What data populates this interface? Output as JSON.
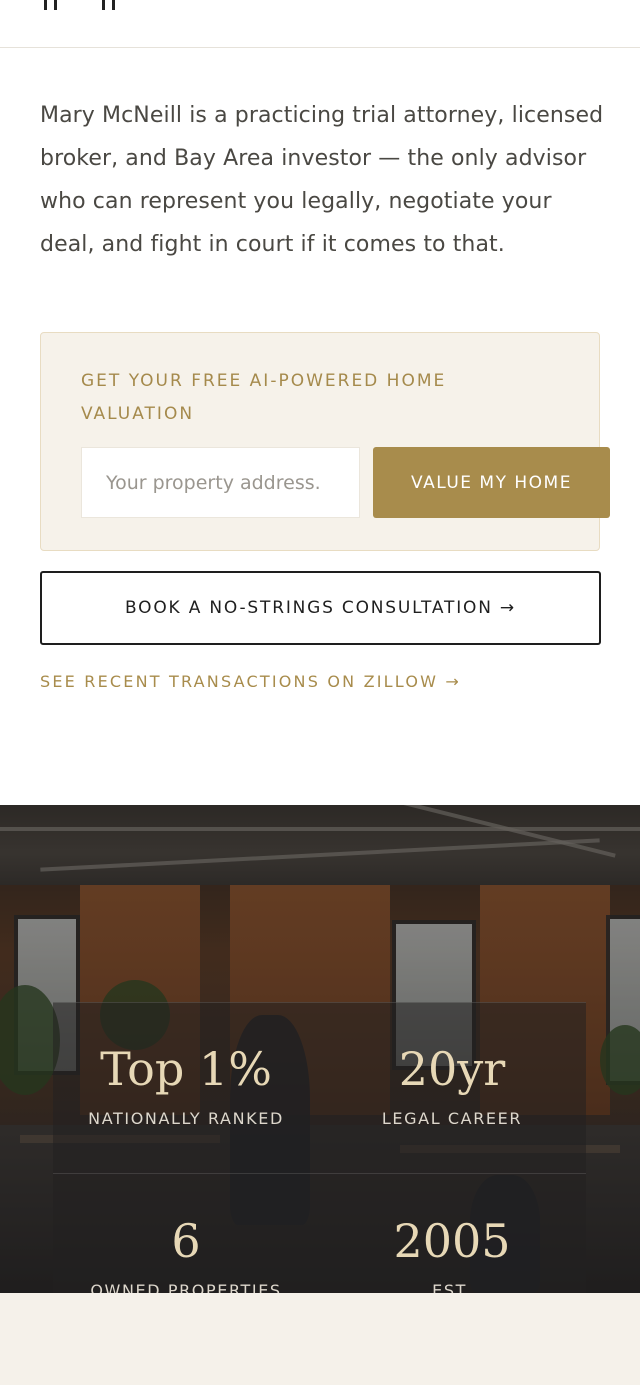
{
  "intro": {
    "text": "Mary McNeill is a practicing trial attorney, licensed broker, and Bay Area investor — the only advisor who can represent you legally, negotiate your deal, and fight in court if it comes to that."
  },
  "valuation": {
    "title": "GET YOUR FREE AI-POWERED HOME VALUATION",
    "address_placeholder": "Your property address.",
    "address_value": "",
    "button_label": "VALUE MY HOME"
  },
  "consultation": {
    "button_label": "BOOK A NO-STRINGS CONSULTATION →"
  },
  "zillow": {
    "link_label": "SEE RECENT TRANSACTIONS ON ZILLOW →"
  },
  "stats": [
    {
      "value": "Top 1%",
      "label": "NATIONALLY RANKED"
    },
    {
      "value": "20yr",
      "label": "LEGAL CAREER"
    },
    {
      "value": "6",
      "label": "OWNED PROPERTIES"
    },
    {
      "value": "2005",
      "label": "EST."
    }
  ],
  "colors": {
    "accent": "#a88c4c",
    "card_background": "#f6f2ea",
    "page_background": "#f5f1ea",
    "stat_number": "#e7d8b6"
  }
}
